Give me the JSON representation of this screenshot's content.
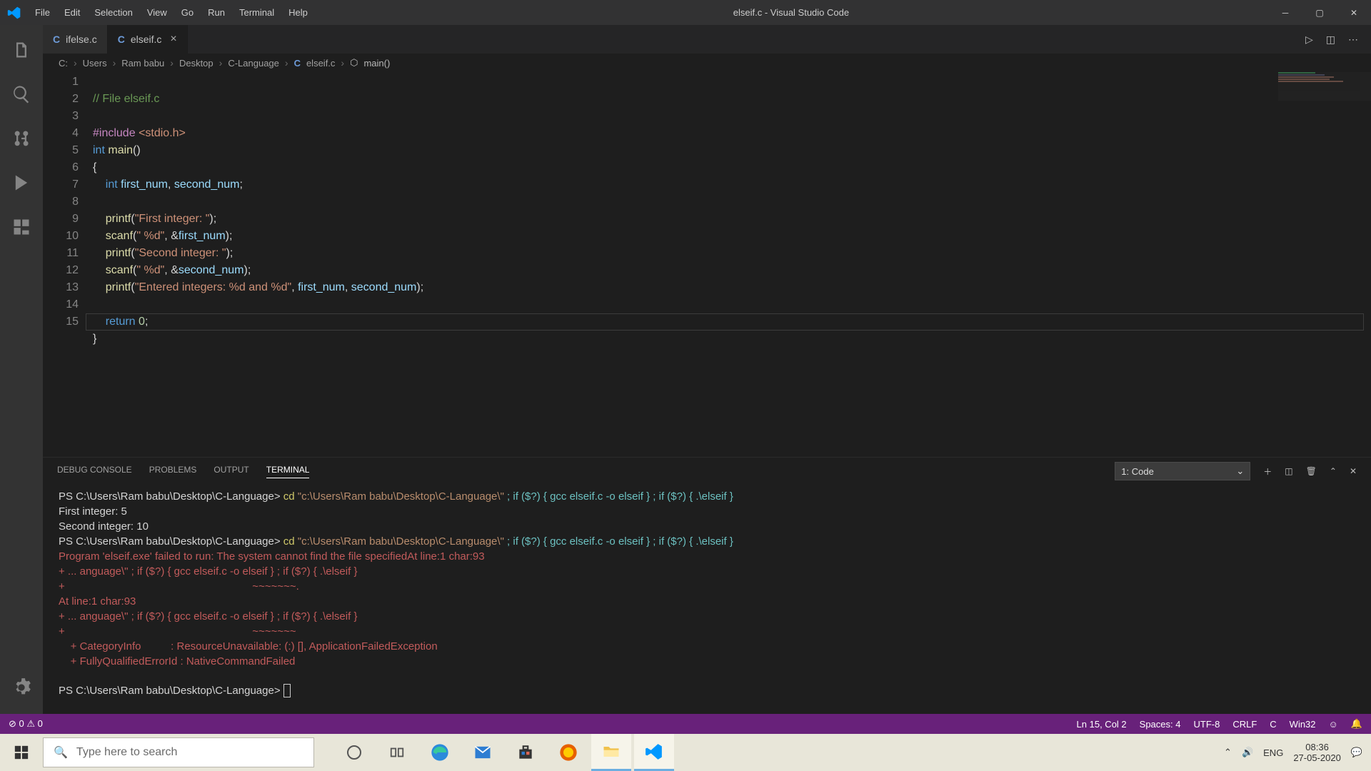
{
  "title": "elseif.c - Visual Studio Code",
  "menu": [
    "File",
    "Edit",
    "Selection",
    "View",
    "Go",
    "Run",
    "Terminal",
    "Help"
  ],
  "tabs": [
    {
      "label": "ifelse.c",
      "active": false
    },
    {
      "label": "elseif.c",
      "active": true
    }
  ],
  "breadcrumb": {
    "parts": [
      "C:",
      "Users",
      "Ram babu",
      "Desktop",
      "C-Language"
    ],
    "file": "elseif.c",
    "symbol": "main()"
  },
  "panel_tabs": [
    "DEBUG CONSOLE",
    "PROBLEMS",
    "OUTPUT",
    "TERMINAL"
  ],
  "panel_active": "TERMINAL",
  "terminal_select": "1: Code",
  "status": {
    "errors": "0",
    "warnings": "0",
    "ln": "Ln 15, Col 2",
    "spaces": "Spaces: 4",
    "enc": "UTF-8",
    "eol": "CRLF",
    "lang": "C",
    "os": "Win32"
  },
  "taskbar": {
    "search_placeholder": "Type here to search",
    "lang": "ENG",
    "time": "08:36",
    "date": "27-05-2020"
  },
  "terminal_lines": {
    "l1p": "PS C:\\Users\\Ram babu\\Desktop\\C-Language> ",
    "l1c": "cd ",
    "l1s": "\"c:\\Users\\Ram babu\\Desktop\\C-Language\\\"",
    "l1r": " ; if ($?) { gcc elseif.c -o elseif } ; if ($?) { .\\elseif }",
    "l2": "First integer: 5",
    "l3": "Second integer: 10",
    "l4p": "PS C:\\Users\\Ram babu\\Desktop\\C-Language> ",
    "l4c": "cd ",
    "l4s": "\"c:\\Users\\Ram babu\\Desktop\\C-Language\\\"",
    "l4r": " ; if ($?) { gcc elseif.c -o elseif } ; if ($?) { .\\elseif }",
    "l5": "Program 'elseif.exe' failed to run: The system cannot find the file specifiedAt line:1 char:93",
    "l6": "+ ... anguage\\\" ; if ($?) { gcc elseif.c -o elseif } ; if ($?) { .\\elseif }",
    "l7": "+                                                               ~~~~~~~.",
    "l8": "At line:1 char:93",
    "l9": "+ ... anguage\\\" ; if ($?) { gcc elseif.c -o elseif } ; if ($?) { .\\elseif }",
    "l10": "+                                                               ~~~~~~~",
    "l11": "    + CategoryInfo          : ResourceUnavailable: (:) [], ApplicationFailedException",
    "l12": "    + FullyQualifiedErrorId : NativeCommandFailed",
    "l13": "PS C:\\Users\\Ram babu\\Desktop\\C-Language> "
  }
}
